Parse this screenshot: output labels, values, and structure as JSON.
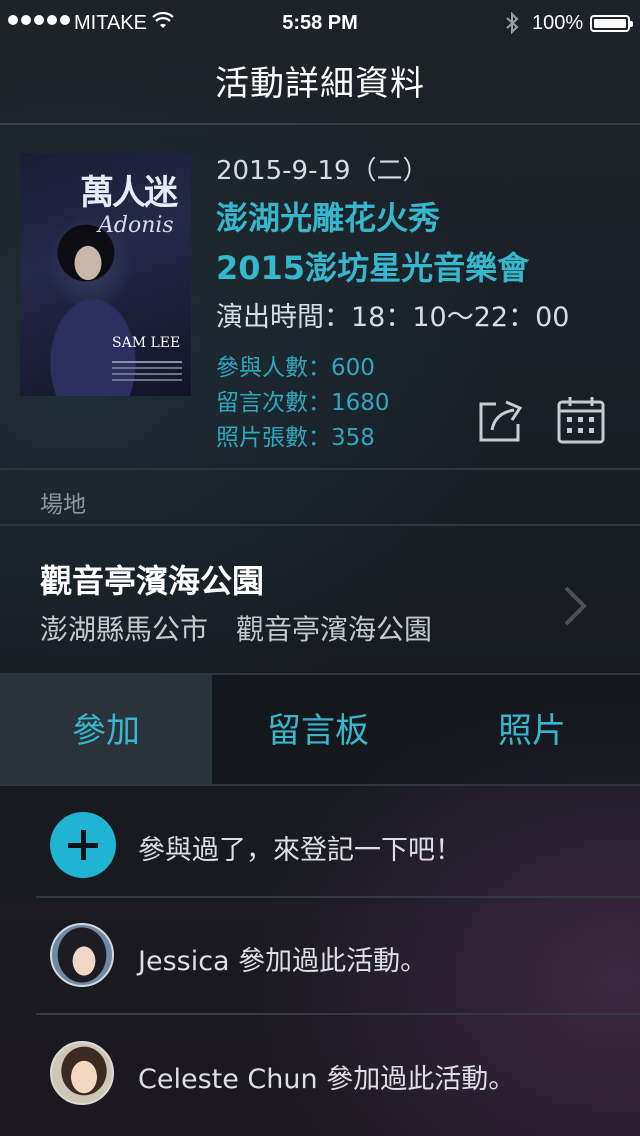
{
  "status_bar": {
    "carrier": "MITAKE",
    "time": "5:58 PM",
    "battery": "100%"
  },
  "nav": {
    "title": "活動詳細資料"
  },
  "event": {
    "date": "2015-9-19（二）",
    "title_line1": "澎湖光雕花火秀",
    "title_line2": "2015澎坊星光音樂會",
    "time": "演出時間：18：10～22：00",
    "participants": "參與人數：600",
    "comments": "留言次數：1680",
    "photos": "照片張數：358",
    "poster": {
      "title": "萬人迷",
      "subtitle": "Adonis",
      "artist": "SAM LEE"
    }
  },
  "venue": {
    "header": "場地",
    "name": "觀音亭濱海公園",
    "address": "澎湖縣馬公市　觀音亭濱海公園"
  },
  "tabs": [
    {
      "label": "參加",
      "selected": true
    },
    {
      "label": "留言板",
      "selected": false
    },
    {
      "label": "照片",
      "selected": false
    }
  ],
  "list": {
    "add_prompt": "參與過了，來登記一下吧！",
    "items": [
      {
        "text": "Jessica 參加過此活動。"
      },
      {
        "text": "Celeste Chun 參加過此活動。"
      }
    ]
  },
  "colors": {
    "accent": "#36b7cd",
    "add_button": "#1fb4d2",
    "background": "#1a2027"
  }
}
